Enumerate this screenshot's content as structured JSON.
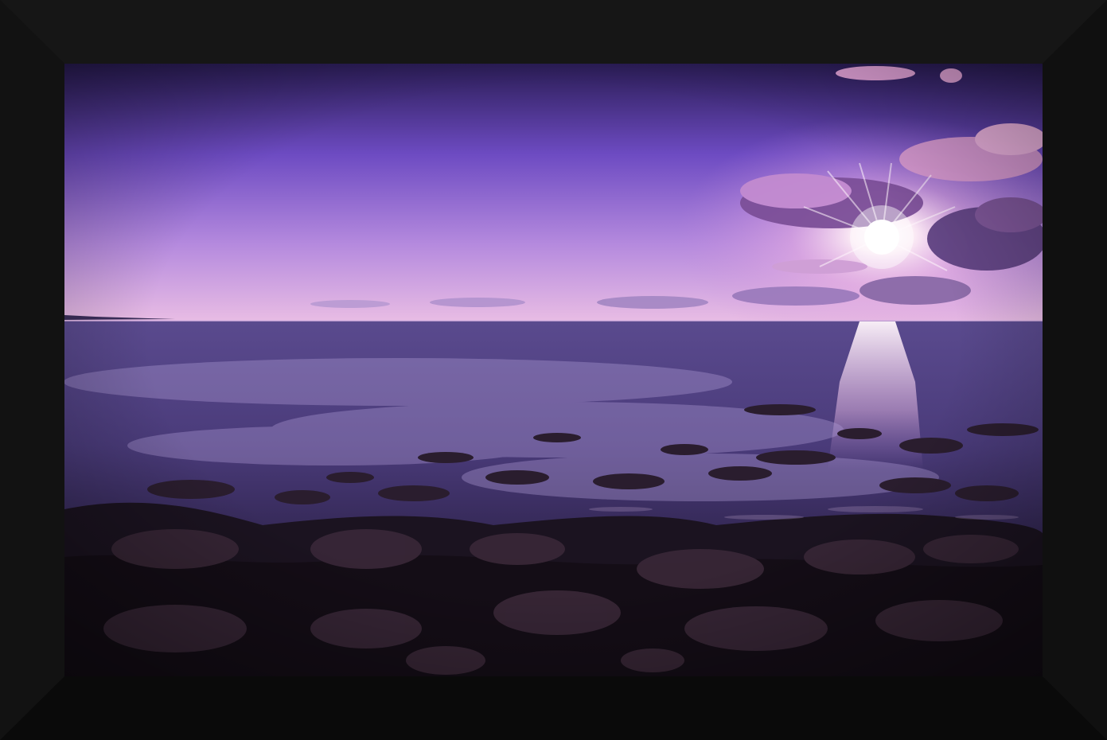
{
  "scene": {
    "subject": "framed-photo",
    "frame_color": "#0d0d0d",
    "sky_top": "#2e1f5c",
    "sky_mid": "#8b5fd0",
    "sky_horizon": "#e0b2e6",
    "sea_color": "#4b3c78",
    "rock_color": "#1a1218",
    "sun_color": "#fff4f8"
  }
}
